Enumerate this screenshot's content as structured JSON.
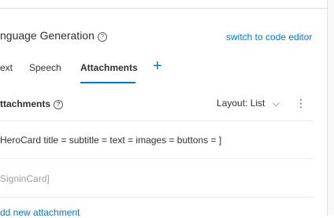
{
  "header": {
    "title": "nguage Generation",
    "help_glyph": "?",
    "switch_link": "switch to code editor"
  },
  "tabs": [
    {
      "label": "ext"
    },
    {
      "label": "Speech"
    },
    {
      "label": "Attachments",
      "active": true
    }
  ],
  "add_tab_glyph": "+",
  "attachments": {
    "heading": "ttachments",
    "help_glyph": "?",
    "layout_label": "Layout: List",
    "chevron_glyph": "⌵",
    "more_glyph": "⋮",
    "items": [
      "HeroCard title = subtitle = text = images = buttons = ]",
      "SigninCard]"
    ],
    "add_link": "dd new attachment"
  },
  "colors": {
    "accent": "#0078d4",
    "text": "#323130",
    "muted": "#a19f9d",
    "divider": "#edebe9"
  }
}
